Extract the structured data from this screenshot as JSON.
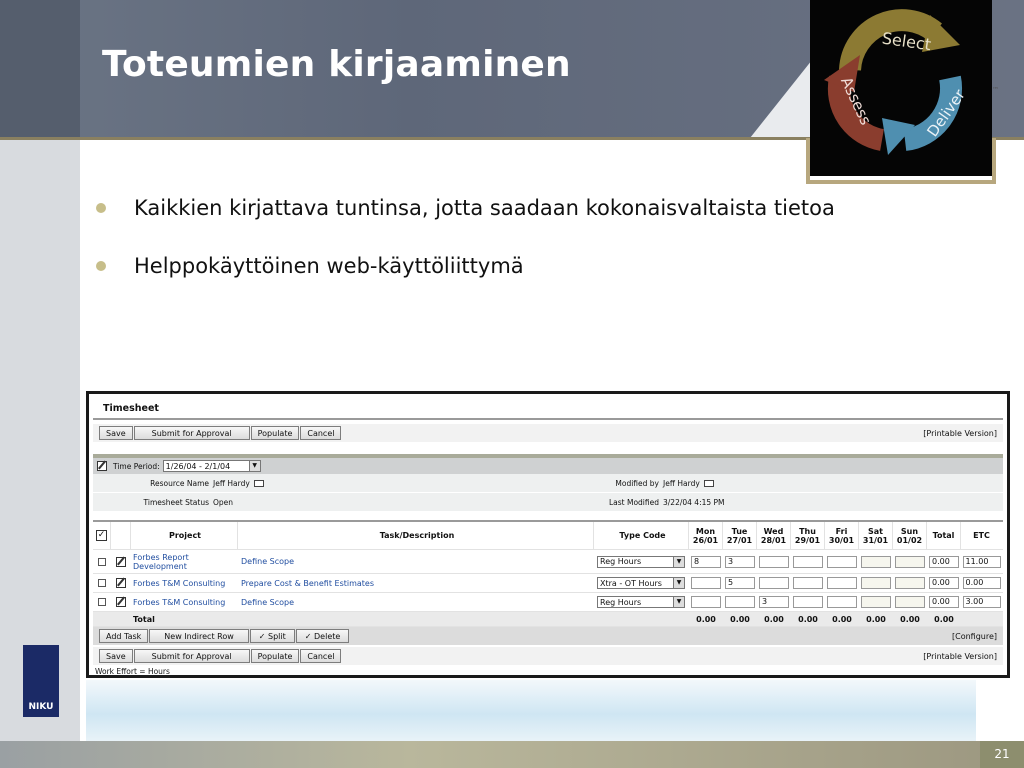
{
  "slide": {
    "title": "Toteumien kirjaaminen",
    "page_number": "21",
    "bullets": [
      "Kaikkien kirjattava tuntinsa, jotta saadaan kokonaisvaltaista tietoa",
      "Helppokäyttöinen web-käyttöliittymä"
    ],
    "logo_words": [
      "Select",
      "Deliver",
      "Assess"
    ],
    "niku_logo": "NIKU"
  },
  "timesheet": {
    "title": "Timesheet",
    "buttons": {
      "save": "Save",
      "submit": "Submit for Approval",
      "populate": "Populate",
      "cancel": "Cancel"
    },
    "printable": "[Printable Version]",
    "time_period_label": "Time Period:",
    "time_period_value": "1/26/04 - 2/1/04",
    "resource_name_label": "Resource Name",
    "resource_name": "Jeff Hardy",
    "status_label": "Timesheet Status",
    "status": "Open",
    "modified_by_label": "Modified by",
    "modified_by": "Jeff Hardy",
    "last_modified_label": "Last Modified",
    "last_modified": "3/22/04 4:15 PM",
    "columns": {
      "project": "Project",
      "task": "Task/Description",
      "type": "Type Code",
      "total": "Total",
      "etc": "ETC"
    },
    "days": [
      {
        "d": "Mon",
        "date": "26/01"
      },
      {
        "d": "Tue",
        "date": "27/01"
      },
      {
        "d": "Wed",
        "date": "28/01"
      },
      {
        "d": "Thu",
        "date": "29/01"
      },
      {
        "d": "Fri",
        "date": "30/01"
      },
      {
        "d": "Sat",
        "date": "31/01"
      },
      {
        "d": "Sun",
        "date": "01/02"
      }
    ],
    "rows": [
      {
        "project": "Forbes Report Development",
        "task": "Define Scope",
        "type": "Reg Hours",
        "hours": [
          "8",
          "3",
          "",
          "",
          "",
          "",
          ""
        ],
        "total": "0.00",
        "etc": "11.00"
      },
      {
        "project": "Forbes T&M Consulting",
        "task": "Prepare Cost & Benefit Estimates",
        "type": "Xtra - OT Hours",
        "hours": [
          "",
          "5",
          "",
          "",
          "",
          "",
          ""
        ],
        "total": "0.00",
        "etc": "0.00"
      },
      {
        "project": "Forbes T&M Consulting",
        "task": "Define Scope",
        "type": "Reg Hours",
        "hours": [
          "",
          "",
          "3",
          "",
          "",
          "",
          ""
        ],
        "total": "0.00",
        "etc": "3.00"
      }
    ],
    "total_label": "Total",
    "totals": [
      "0.00",
      "0.00",
      "0.00",
      "0.00",
      "0.00",
      "0.00",
      "0.00",
      "0.00"
    ],
    "action_buttons": {
      "add_task": "Add Task",
      "new_indirect": "New Indirect Row",
      "split": "✓ Split",
      "delete": "✓ Delete"
    },
    "configure": "[Configure]",
    "footer_note": "Work Effort = Hours"
  }
}
